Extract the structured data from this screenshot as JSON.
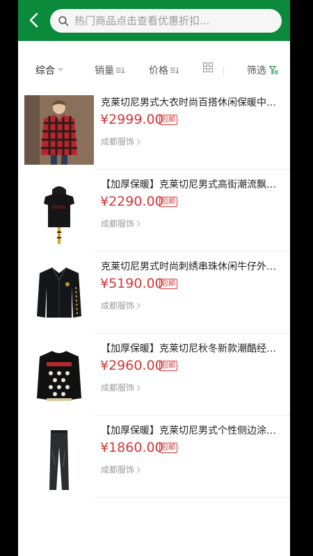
{
  "search": {
    "placeholder": "热门商品点击查看优惠折扣..."
  },
  "filters": {
    "comprehensive": "综合",
    "sales": "销量",
    "price": "价格",
    "filter": "筛选"
  },
  "products": [
    {
      "title": "克莱切尼男式大衣时尚百搭休闲保暖中长...",
      "price": "¥2999.00",
      "tag": "包邮",
      "shop": "成都服饰"
    },
    {
      "title": "【加厚保暖】克莱切尼男式高街潮流飘带...",
      "price": "¥2290.00",
      "tag": "包邮",
      "shop": "成都服饰"
    },
    {
      "title": "克莱切尼男式时尚刺绣串珠休闲牛仔外套...",
      "price": "¥5190.00",
      "tag": "包邮",
      "shop": "成都服饰"
    },
    {
      "title": "【加厚保暖】克莱切尼秋冬新款潮酷经典...",
      "price": "¥2960.00",
      "tag": "包邮",
      "shop": "成都服饰"
    },
    {
      "title": "【加厚保暖】克莱切尼男式个性侧边涂鸦...",
      "price": "¥1860.00",
      "tag": "包邮",
      "shop": "成都服饰"
    }
  ],
  "colors": {
    "header": "#0b8a3c",
    "price": "#d83536"
  }
}
